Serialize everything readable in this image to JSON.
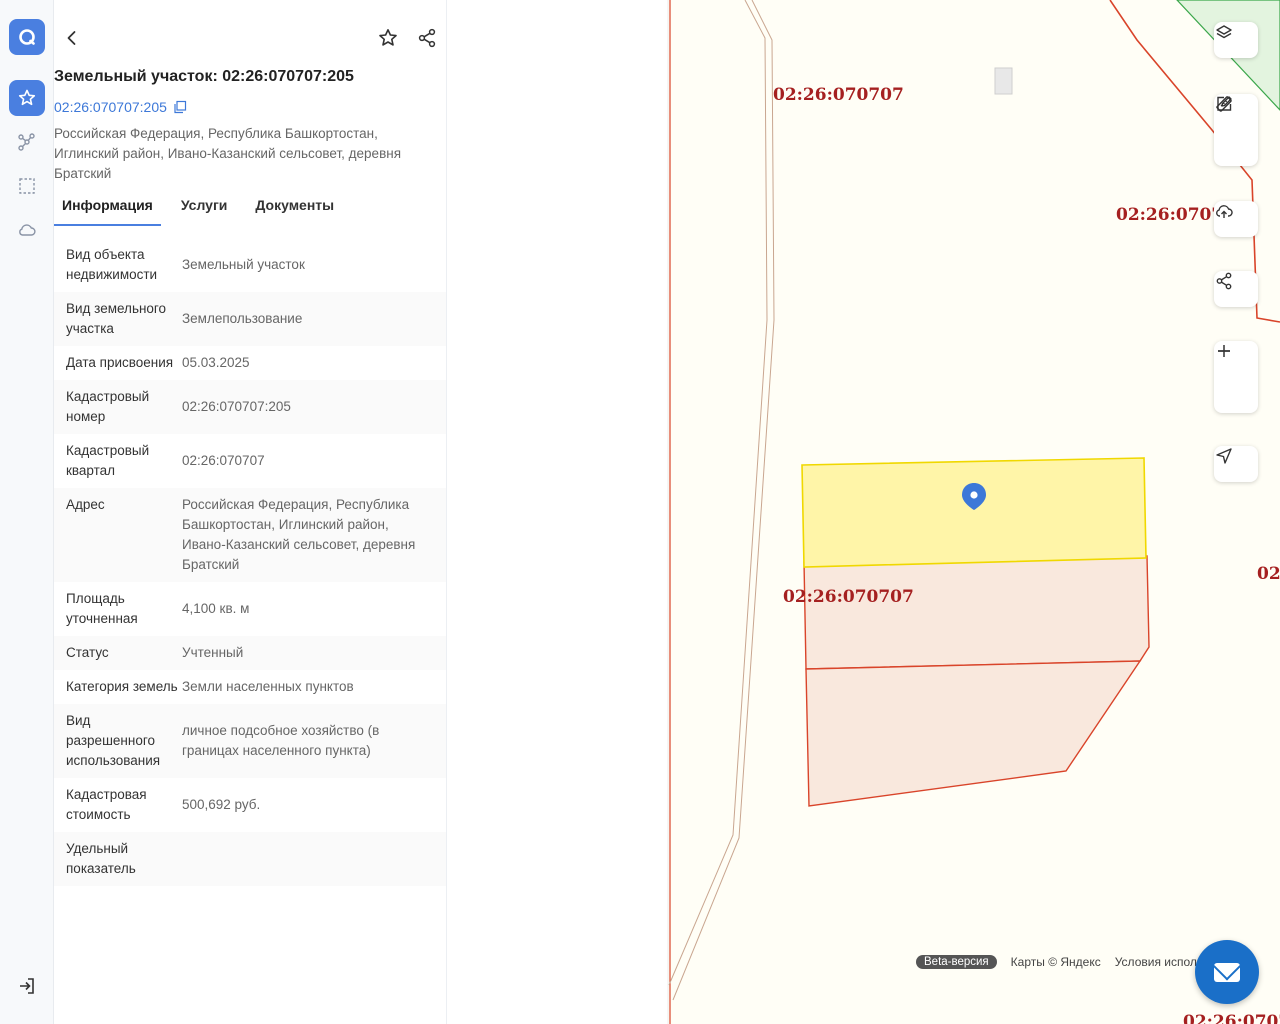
{
  "rail": {
    "items": [
      {
        "name": "logo",
        "icon": "logo-icon"
      },
      {
        "name": "favorites",
        "icon": "star-icon"
      },
      {
        "name": "routes",
        "icon": "nodes-icon"
      },
      {
        "name": "selection",
        "icon": "dashed-square-icon"
      },
      {
        "name": "cloud",
        "icon": "cloud-icon"
      },
      {
        "name": "logout",
        "icon": "logout-icon"
      }
    ]
  },
  "panel": {
    "title": "Земельный участок: 02:26:070707:205",
    "cadastral_link": "02:26:070707:205",
    "address": "Российская Федерация, Республика Башкортостан, Иглинский район, Ивано-Казанский сельсовет, деревня Братский",
    "tabs": [
      {
        "label": "Информация",
        "active": true
      },
      {
        "label": "Услуги",
        "active": false
      },
      {
        "label": "Документы",
        "active": false
      }
    ],
    "rows": [
      {
        "key": "Вид объекта недвижимости",
        "value": "Земельный участок"
      },
      {
        "key": "Вид земельного участка",
        "value": "Землепользование"
      },
      {
        "key": "Дата присвоения",
        "value": "05.03.2025"
      },
      {
        "key": "Кадастровый номер",
        "value": "02:26:070707:205"
      },
      {
        "key": "Кадастровый квартал",
        "value": "02:26:070707"
      },
      {
        "key": "Адрес",
        "value": "Российская Федерация, Республика Башкортостан, Иглинский район, Ивано-Казанский сельсовет, деревня Братский"
      },
      {
        "key": "Площадь уточненная",
        "value": "4,100 кв. м"
      },
      {
        "key": "Статус",
        "value": "Учтенный"
      },
      {
        "key": "Категория земель",
        "value": "Земли населенных пунктов"
      },
      {
        "key": "Вид разрешенного использования",
        "value": "личное подсобное хозяйство (в границах населенного пункта)"
      },
      {
        "key": "Кадастровая стоимость",
        "value": "500,692 руб."
      },
      {
        "key": "Удельный показатель",
        "value": ""
      }
    ]
  },
  "map": {
    "labels": {
      "l1": "02:26:070707",
      "l2": "02:26:0707",
      "l3": "02:26:070707",
      "l4": "02",
      "l5": "02:26:0707"
    },
    "footer": {
      "beta": "Beta-версия",
      "copyright": "Карты © Яндекс",
      "terms": "Условия испол"
    }
  },
  "colors": {
    "accent": "#4a7fe0",
    "link": "#3d78d8",
    "selected_parcel": "#fff5a8",
    "parcel": "#f9e8dd",
    "parcel_border": "#d9442a",
    "label": "#a52020",
    "fab": "#1a6fc8"
  }
}
